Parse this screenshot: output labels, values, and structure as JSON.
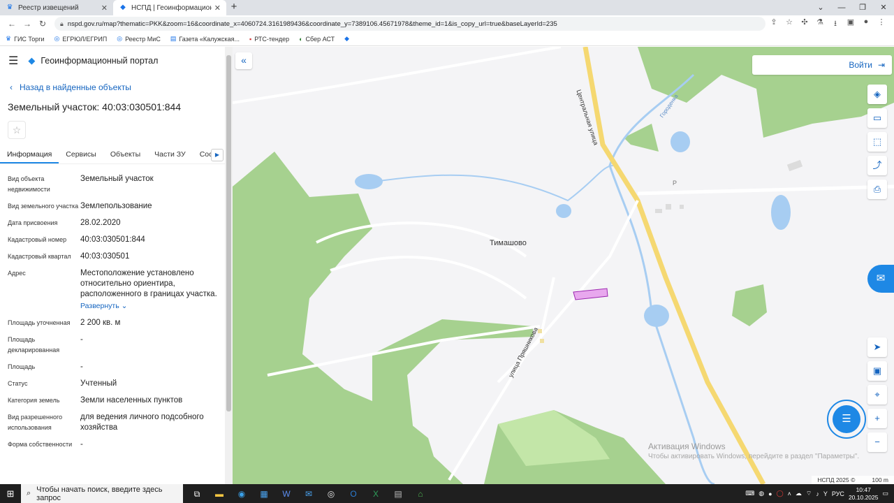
{
  "browser": {
    "tabs": [
      {
        "title": "Реестр извещений",
        "active": false
      },
      {
        "title": "НСПД | Геоинформационный п",
        "active": true
      }
    ],
    "url": "nspd.gov.ru/map?thematic=PKK&zoom=16&coordinate_x=4060724.3161989436&coordinate_y=7389106.45671978&theme_id=1&is_copy_url=true&baseLayerId=235",
    "bookmarks": [
      "ГИС Торги",
      "ЕГРЮЛ/ЕГРИП",
      "Реестр МиС",
      "Газета «Калужская...",
      "РТС-тендер",
      "Сбер АСТ"
    ]
  },
  "sidebar": {
    "portal_title": "Геоинформационный портал",
    "back_label": "Назад в найденные объекты",
    "object_title": "Земельный участок: 40:03:030501:844",
    "tabs": [
      "Информация",
      "Сервисы",
      "Объекты",
      "Части ЗУ",
      "Соста"
    ],
    "info": [
      {
        "label": "Вид объекта недвижимости",
        "value": "Земельный участок"
      },
      {
        "label": "Вид земельного участка",
        "value": "Землепользование"
      },
      {
        "label": "Дата присвоения",
        "value": "28.02.2020"
      },
      {
        "label": "Кадастровый номер",
        "value": "40:03:030501:844"
      },
      {
        "label": "Кадастровый квартал",
        "value": "40:03:030501"
      },
      {
        "label": "Адрес",
        "value": "Местоположение установлено относительно ориентира, расположенного в границах участка."
      },
      {
        "label": "Площадь уточненная",
        "value": "2 200 кв. м"
      },
      {
        "label": "Площадь декларированная",
        "value": "-"
      },
      {
        "label": "Площадь",
        "value": "-"
      },
      {
        "label": "Статус",
        "value": "Учтенный"
      },
      {
        "label": "Категория земель",
        "value": "Земли населенных пунктов"
      },
      {
        "label": "Вид разрешенного использования",
        "value": "для ведения личного подсобного хозяйства"
      },
      {
        "label": "Форма собственности",
        "value": "-"
      }
    ],
    "expand_label": "Развернуть"
  },
  "map": {
    "login_label": "Войти",
    "village_label": "Тимашово",
    "street_central": "Центральная улица",
    "street_pryan": "улица Пряшникова",
    "river_label": "Городенка",
    "parking_label": "Р",
    "watermark_title": "Активация Windows",
    "watermark_sub": "Чтобы активировать Windows, перейдите в раздел \"Параметры\".",
    "attribution": "НСПД 2025 ©",
    "scale": "100 m",
    "colors": {
      "forest": "#a6d18f",
      "forest_light": "#c3e6a8",
      "water": "#a7cdf2",
      "road": "#f5d871",
      "parcel": "#e8a8ee"
    }
  },
  "taskbar": {
    "search_placeholder": "Чтобы начать поиск, введите здесь запрос",
    "lang": "РУС",
    "time": "10:47",
    "date": "20.10.2025"
  }
}
